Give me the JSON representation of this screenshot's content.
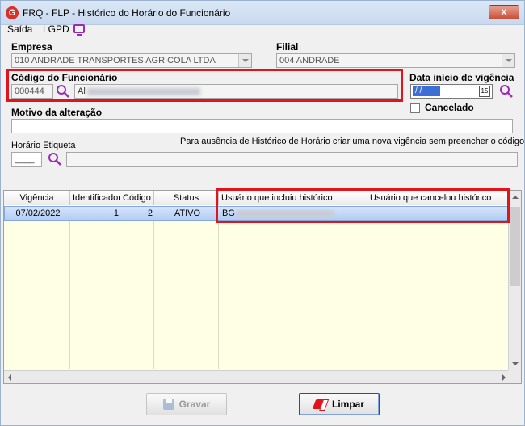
{
  "window": {
    "title": "FRQ - FLP - Histórico do Horário do Funcionário",
    "close_label": "x",
    "app_icon_letter": "G"
  },
  "menu": {
    "saida": "Saída",
    "lgpd": "LGPD"
  },
  "form": {
    "empresa_label": "Empresa",
    "empresa_value": "010 ANDRADE TRANSPORTES AGRICOLA LTDA",
    "filial_label": "Filial",
    "filial_value": "004 ANDRADE",
    "codigo_label": "Código do Funcionário",
    "codigo_value": "000444",
    "nome_value": "Al",
    "data_label": "Data início de vigência",
    "data_value": "/ /",
    "cal_label": "15",
    "cancelado_label": "Cancelado",
    "motivo_label": "Motivo da alteração",
    "motivo_value": "",
    "horario_label": "Horário Etiqueta",
    "horario_value": "____",
    "info_text": "Para ausência de Histórico de Horário criar uma nova vigência sem preencher o código"
  },
  "grid": {
    "columns": [
      "Vigência",
      "Identificador",
      "Código",
      "Status",
      "Usuário que incluiu histórico",
      "Usuário que cancelou histórico"
    ],
    "rows": [
      {
        "vigencia": "07/02/2022",
        "identificador": "1",
        "codigo": "2",
        "status": "ATIVO",
        "usuario_incluiu": "BG",
        "usuario_cancelou": ""
      }
    ]
  },
  "buttons": {
    "gravar": "Gravar",
    "limpar": "Limpar"
  },
  "colors": {
    "highlight_red": "#e0141a",
    "selection_blue": "#b3cdf4",
    "grid_bg": "#ffffe6",
    "search_purple": "#9b2bb3"
  }
}
